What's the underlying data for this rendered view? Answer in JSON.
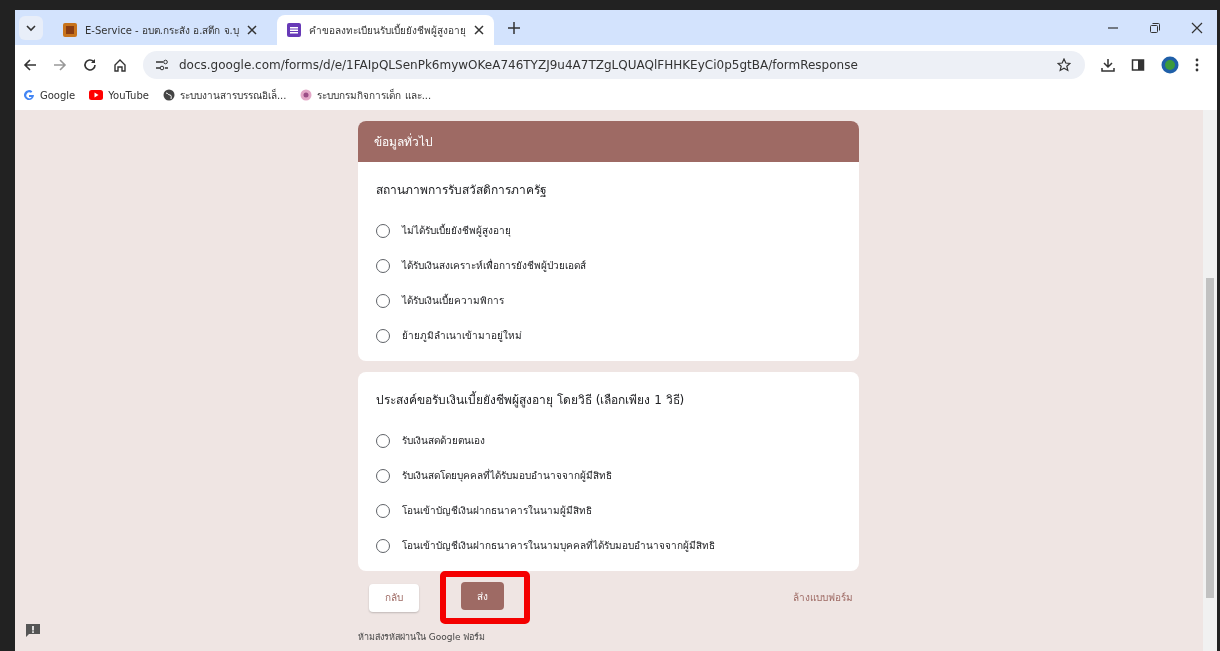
{
  "tabs": [
    {
      "title": "E-Service - อบต.กระสัง อ.สตึก จ.บุ",
      "selected": false
    },
    {
      "title": "คำขอลงทะเบียนรับเบี้ยยังชีพผู้สูงอายุ",
      "selected": true
    }
  ],
  "address_bar": {
    "url": "docs.google.com/forms/d/e/1FAIpQLSenPk6mywOKeA746TYZJ9u4A7TZgLQUAQlFHHKEyCi0p5gtBA/formResponse"
  },
  "bookmarks": [
    {
      "label": "Google",
      "kind": "google"
    },
    {
      "label": "YouTube",
      "kind": "youtube"
    },
    {
      "label": "ระบบงานสารบรรณอิเล็...",
      "kind": "globe"
    },
    {
      "label": "ระบบกรมกิจการเด็ก และ...",
      "kind": "logo"
    }
  ],
  "sections": [
    {
      "header": "ข้อมูลทั่วไป",
      "question": "สถานภาพการรับสวัสดิการภาครัฐ",
      "options": [
        {
          "label": "ไม่ได้รับเบี้ยยังชีพผู้สูงอายุ",
          "selected": false
        },
        {
          "label": "ได้รับเงินสงเคราะห์เพื่อการยังชีพผู้ป่วยเอดส์",
          "selected": false
        },
        {
          "label": "ได้รับเงินเบี้ยความพิการ",
          "selected": false
        },
        {
          "label": "ย้ายภูมิลำเนาเข้ามาอยู่ใหม่",
          "selected": false
        }
      ]
    },
    {
      "question": "ประสงค์ขอรับเงินเบี้ยยังชีพผู้สูงอายุ โดยวิธี (เลือกเพียง 1 วิธี)",
      "options": [
        {
          "label": "รับเงินสดด้วยตนเอง",
          "selected": false
        },
        {
          "label": "รับเงินสดโดยบุคคลที่ได้รับมอบอำนาจจากผู้มีสิทธิ",
          "selected": false
        },
        {
          "label": "โอนเข้าบัญชีเงินฝากธนาคารในนามผู้มีสิทธิ",
          "selected": false
        },
        {
          "label": "โอนเข้าบัญชีเงินฝากธนาคารในนามบุคคลที่ได้รับมอบอำนาจจากผู้มีสิทธิ",
          "selected": false
        }
      ]
    }
  ],
  "buttons": [
    {
      "label": "กลับ",
      "kind": "secondary",
      "highlighted": false
    },
    {
      "label": "ส่ง",
      "kind": "primary",
      "highlighted": true
    }
  ],
  "clear_link": "ล้างแบบฟอร์ม",
  "footer_note": "ห้ามส่งรหัสผ่านใน Google ฟอร์ม"
}
